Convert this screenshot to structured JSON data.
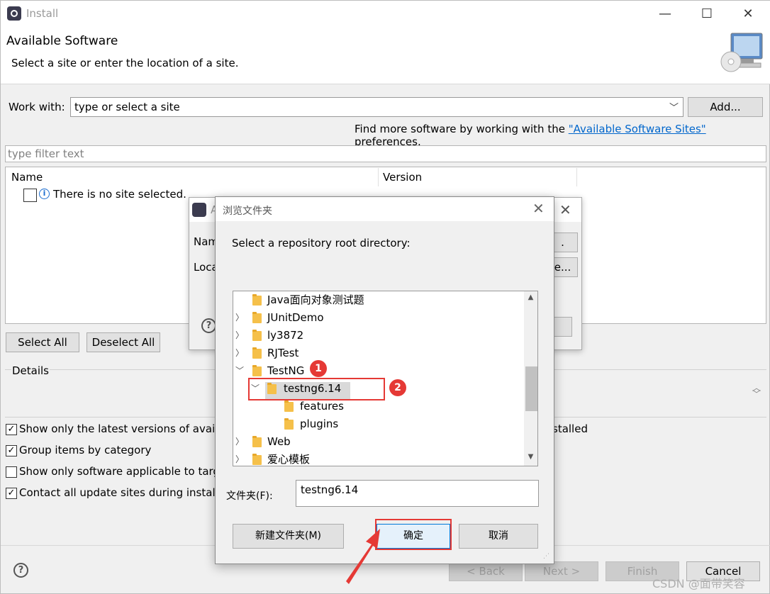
{
  "window": {
    "title": "Install",
    "icon": "eclipse-icon",
    "controls": {
      "minimize": "—",
      "maximize": "☐",
      "close": "✕"
    }
  },
  "banner": {
    "title": "Available Software",
    "description": "Select a site or enter the location of a site."
  },
  "work_with": {
    "label": "Work with:",
    "value": "type or select a site",
    "add_label": "Add..."
  },
  "find_more": {
    "prefix": "Find more software by working with the ",
    "link": "\"Available Software Sites\"",
    "suffix": " preferences."
  },
  "filter": {
    "placeholder": "type filter text"
  },
  "table": {
    "columns": [
      "Name",
      "Version"
    ],
    "rows": [
      {
        "text": "There is no site selected."
      }
    ]
  },
  "buttons": {
    "select_all": "Select All",
    "deselect_all": "Deselect All"
  },
  "details": {
    "label": "Details"
  },
  "options": [
    {
      "label": "Show only the latest versions of availab",
      "checked": true
    },
    {
      "label": "Group items by category",
      "checked": true
    },
    {
      "label": "Show only software applicable to targ",
      "checked": false
    },
    {
      "label": "Contact all update sites during install t",
      "checked": true
    }
  ],
  "options_tail": "stalled",
  "footer": {
    "back": "< Back",
    "next": "Next >",
    "finish": "Finish",
    "cancel": "Cancel"
  },
  "add_repo_dialog": {
    "title": "A",
    "name_label": "Nam",
    "location_label": "Loca",
    "button1": ".",
    "button2": "e..."
  },
  "browse_dialog": {
    "title": "浏览文件夹",
    "prompt": "Select a repository root directory:",
    "tree": [
      {
        "label": "Java面向对象测试题",
        "expander": "",
        "level": 0
      },
      {
        "label": "JUnitDemo",
        "expander": "collapsed",
        "level": 0
      },
      {
        "label": "ly3872",
        "expander": "collapsed",
        "level": 0
      },
      {
        "label": "RJTest",
        "expander": "collapsed",
        "level": 0
      },
      {
        "label": "TestNG",
        "expander": "expanded",
        "level": 0
      },
      {
        "label": "testng6.14",
        "expander": "expanded",
        "level": 1,
        "selected": true
      },
      {
        "label": "features",
        "expander": "",
        "level": 2
      },
      {
        "label": "plugins",
        "expander": "",
        "level": 2
      },
      {
        "label": "Web",
        "expander": "collapsed",
        "level": 0
      },
      {
        "label": "爱心模板",
        "expander": "collapsed",
        "level": 0
      }
    ],
    "folder_label": "文件夹(F):",
    "folder_value": "testng6.14",
    "new_folder": "新建文件夹(M)",
    "ok": "确定",
    "cancel": "取消"
  },
  "annotations": {
    "badge1": "1",
    "badge2": "2",
    "highlight_color": "#e53935"
  },
  "watermark": "CSDN @面带笑容"
}
